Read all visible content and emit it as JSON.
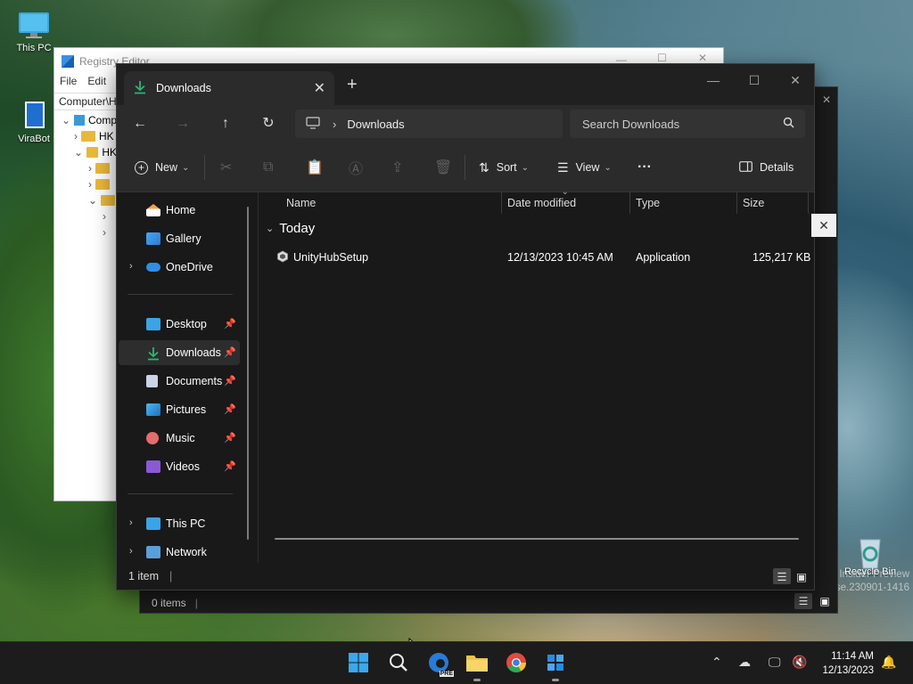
{
  "desktop": {
    "icons": [
      {
        "label": "This PC"
      },
      {
        "label": "ViraBot"
      },
      {
        "label": "Recycle Bin"
      }
    ],
    "watermark_line1": "Windows 11 Pro Insider Preview",
    "watermark_line2": "Evaluation copy. Build 25947.rs_prerelease.230901-1416"
  },
  "regedit": {
    "title": "Registry Editor",
    "menu": [
      "File",
      "Edit"
    ],
    "address": "Computer\\H",
    "tree_labels": [
      "Comp",
      "HK",
      "HK"
    ]
  },
  "explorer_back": {
    "status": "0 items"
  },
  "explorer": {
    "tab_title": "Downloads",
    "breadcrumb": "Downloads",
    "search_placeholder": "Search Downloads",
    "toolbar": {
      "new_label": "New",
      "sort_label": "Sort",
      "view_label": "View",
      "more_label": "···",
      "details_label": "Details"
    },
    "sidebar": {
      "home": "Home",
      "gallery": "Gallery",
      "onedrive": "OneDrive",
      "desktop": "Desktop",
      "downloads": "Downloads",
      "documents": "Documents",
      "pictures": "Pictures",
      "music": "Music",
      "videos": "Videos",
      "thispc": "This PC",
      "network": "Network"
    },
    "columns": [
      "Name",
      "Date modified",
      "Type",
      "Size"
    ],
    "group_label": "Today",
    "files": [
      {
        "name": "UnityHubSetup",
        "date": "12/13/2023 10:45 AM",
        "type": "Application",
        "size": "125,217 KB"
      }
    ],
    "status": "1 item"
  },
  "taskbar": {
    "edge_badge": "PRE",
    "time": "11:14 AM",
    "date": "12/13/2023"
  },
  "colors": {
    "accent": "#4cc2ff",
    "download_green": "#2bb673",
    "explorer_bg": "#191919",
    "toolbar_bg": "#2b2b2b"
  }
}
